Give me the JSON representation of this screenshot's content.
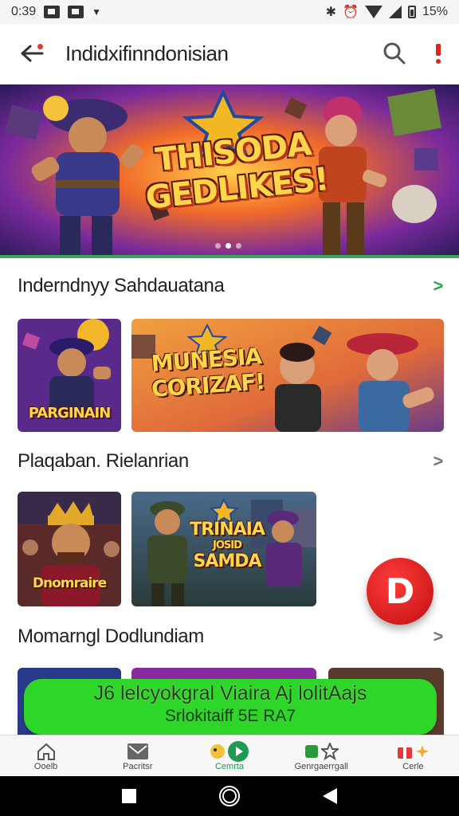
{
  "status_bar": {
    "time": "0:39",
    "battery": "15%"
  },
  "app_bar": {
    "title": "Indidxifinndonisian"
  },
  "hero": {
    "title_line1": "THISODA",
    "title_line2": "GEDLIKES!"
  },
  "sections": [
    {
      "title": "Inderndnyy Sahdauatana"
    },
    {
      "title": "Plaqaban. Rielanrian"
    },
    {
      "title": "Momarngl Dodlundiam"
    }
  ],
  "cards": {
    "s1_c1_label": "PARGINAIN",
    "s1_c2_label_line1": "MUNESIA",
    "s1_c2_label_line2": "CORIZAF!",
    "s2_c1_label": "Dnomraire",
    "s2_c2_label_line1": "TRINAIA",
    "s2_c2_label_line2": "JOSID",
    "s2_c2_label_line3": "SAMDA"
  },
  "fab": {
    "label": "D"
  },
  "promo": {
    "main": "J6 lelcyokgral Viaira Aj lolitAajs",
    "sub": "Srlokitaiff 5E RA7"
  },
  "bottom_nav": [
    {
      "label": "Ooelb",
      "icon": "home-icon"
    },
    {
      "label": "Pacritsr",
      "icon": "mail-icon"
    },
    {
      "label": "Cemrta",
      "icon": "play-icon"
    },
    {
      "label": "Genrgaerrgall",
      "icon": "games-icon"
    },
    {
      "label": "Cerle",
      "icon": "gift-icon"
    }
  ],
  "colors": {
    "accent": "#37a85a",
    "promo": "#2ed62a",
    "fab": "#d81414"
  }
}
